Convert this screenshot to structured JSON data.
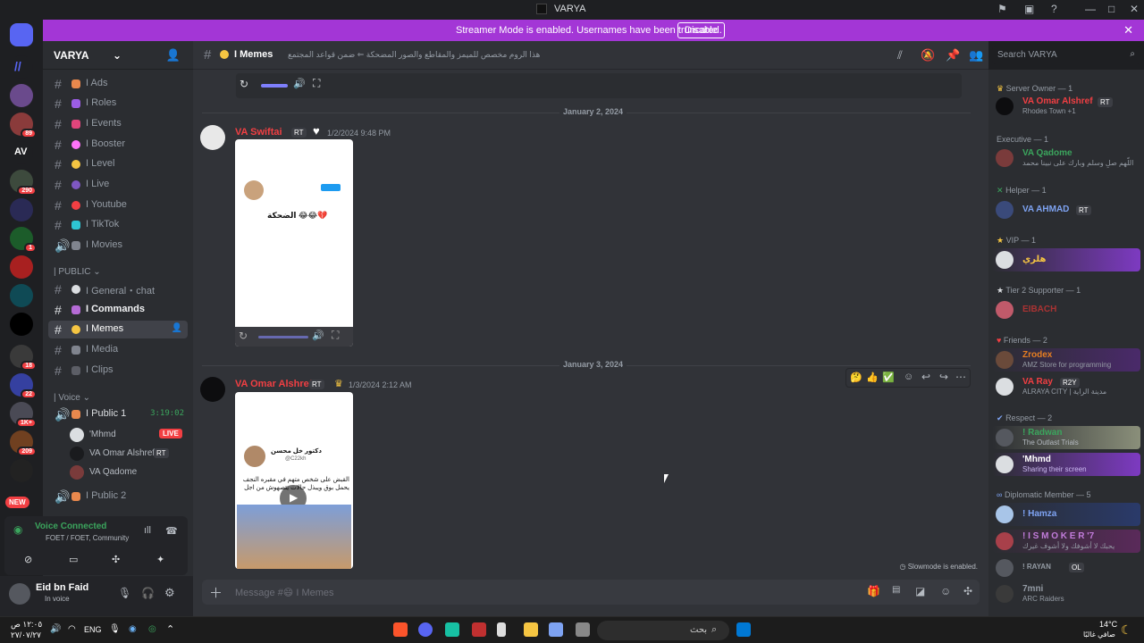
{
  "window": {
    "title": "VARYA"
  },
  "banner": {
    "message": "Streamer Mode is enabled. Usernames have been truncated.",
    "disable": "Disable"
  },
  "servers": {
    "badges": [
      "89",
      "290",
      "1",
      "18",
      "22",
      "1K+",
      "209",
      "NEW"
    ],
    "av_label": "AV"
  },
  "sidebar": {
    "server_name": "VARYA",
    "channels": [
      {
        "label": "I Ads",
        "color": "#e8884d"
      },
      {
        "label": "I Roles",
        "color": "#9b5de5"
      },
      {
        "label": "I Events",
        "color": "#e0457b"
      },
      {
        "label": "I Booster",
        "color": "#ff73fa"
      },
      {
        "label": "I Level",
        "color": "#f5c542"
      },
      {
        "label": "I Live",
        "color": "#7e57c2"
      },
      {
        "label": "I Youtube",
        "color": "#f23f43"
      },
      {
        "label": "I TikTok",
        "color": "#2ec5d3"
      },
      {
        "label": "I Movies",
        "color": "#80848e"
      }
    ],
    "public_category": "| PUBLIC",
    "public_channels": [
      {
        "label": "I General・chat"
      },
      {
        "label": "I Commands"
      },
      {
        "label": "I Memes"
      },
      {
        "label": "I Media"
      },
      {
        "label": "I Clips"
      }
    ],
    "voice_category": "| Voice",
    "voice_channels": [
      {
        "label": "I Public 1",
        "timer": "3:19:02"
      },
      {
        "label": "I Public 2"
      }
    ],
    "voice_users": [
      {
        "name": "'Mhmd",
        "live": "LIVE"
      },
      {
        "name": "VA Omar Alshref",
        "tag": "RT"
      },
      {
        "name": "VA Qadome"
      }
    ],
    "voice_connected": "Voice Connected",
    "voice_server": "FOET / FOET, Community",
    "user": {
      "name": "Eid bn Faid",
      "status": "In voice"
    }
  },
  "header": {
    "channel": "I Memes",
    "topic": "هذا الروم مخصص للميمز والمقاطع والصور المضحكة ⇐ ضمن قواعد المجتمع",
    "search": "Search VARYA"
  },
  "messages": {
    "date1": "January 2, 2024",
    "msg1": {
      "author": "VA Swiftai",
      "tag": "RT",
      "time": "1/2/2024 9:48 PM",
      "tweet_text": "الضحكة 😂😂💔"
    },
    "date2": "January 3, 2024",
    "msg2": {
      "author": "VA Omar Alshref",
      "tag": "RT",
      "time": "1/3/2024 2:12 AM",
      "tweet_author": "دكتور خل محسن",
      "tweet_handle": "@C22kh",
      "tweet_text": "القبض على شخص متهم في مقبره النجف يحمل بوق ويبذل حالات يتصهوش من اجل"
    }
  },
  "composer": {
    "placeholder": "Message #😄 I Memes"
  },
  "slowmode": "Slowmode is enabled.",
  "members": {
    "groups": [
      {
        "title": "Server Owner — 1",
        "members": [
          {
            "name": "VA Omar Alshref",
            "tag": "RT",
            "status": "Rhodes Town +1",
            "color": "#f23f43"
          }
        ]
      },
      {
        "title": "Executive — 1",
        "members": [
          {
            "name": "VA Qadome",
            "status": "اللّهم صلِ وسلم وبارك على نبينا محمد",
            "color": "#3ba55d"
          }
        ]
      },
      {
        "title": "Helper — 1",
        "members": [
          {
            "name": "VA AHMAD",
            "tag": "RT",
            "status": "",
            "color": "#7ea3f2"
          }
        ]
      },
      {
        "title": "VIP — 1",
        "members": [
          {
            "name": "هلري",
            "status": "",
            "color": "#f5c542"
          }
        ]
      },
      {
        "title": "Tier 2 Supporter — 1",
        "members": [
          {
            "name": "EIBACH",
            "status": "",
            "color": "#c0392b"
          }
        ]
      },
      {
        "title": "Friends — 2",
        "members": [
          {
            "name": "Zrodex",
            "status": "AMZ Store for programming",
            "color": "#e67e22"
          },
          {
            "name": "VA Ray",
            "tag": "R2Y",
            "status": "ALRAYA CITY | مدينة الراية",
            "color": "#f23f43"
          }
        ]
      },
      {
        "title": "Respect — 2",
        "members": [
          {
            "name": "! Radwan",
            "status": "The Outlast Trials",
            "color": "#3ba55d"
          },
          {
            "name": "'Mhmd",
            "status": "Sharing their screen",
            "color": "#fff"
          }
        ]
      },
      {
        "title": "Diplomatic Member — 5",
        "members": [
          {
            "name": "! Hamza",
            "status": "",
            "color": "#7ea3f2"
          },
          {
            "name": "! I S M O K E R '7",
            "status": "يحبك لا أشوفك ولا أشوف غيرك",
            "color": "#c27cdb"
          },
          {
            "name": "! RAYAN",
            "tag": "OL",
            "status": "",
            "color": "#949ba4"
          },
          {
            "name": "7mni",
            "status": "ARC Raiders",
            "color": "#949ba4"
          }
        ]
      }
    ]
  },
  "taskbar": {
    "time": "١٢:٠٥ ص",
    "date": "٢٧/٠٧/٢٧",
    "lang": "ENG",
    "search": "بحث",
    "weather": "14°C",
    "weather_desc": "صافي غالبًا"
  }
}
